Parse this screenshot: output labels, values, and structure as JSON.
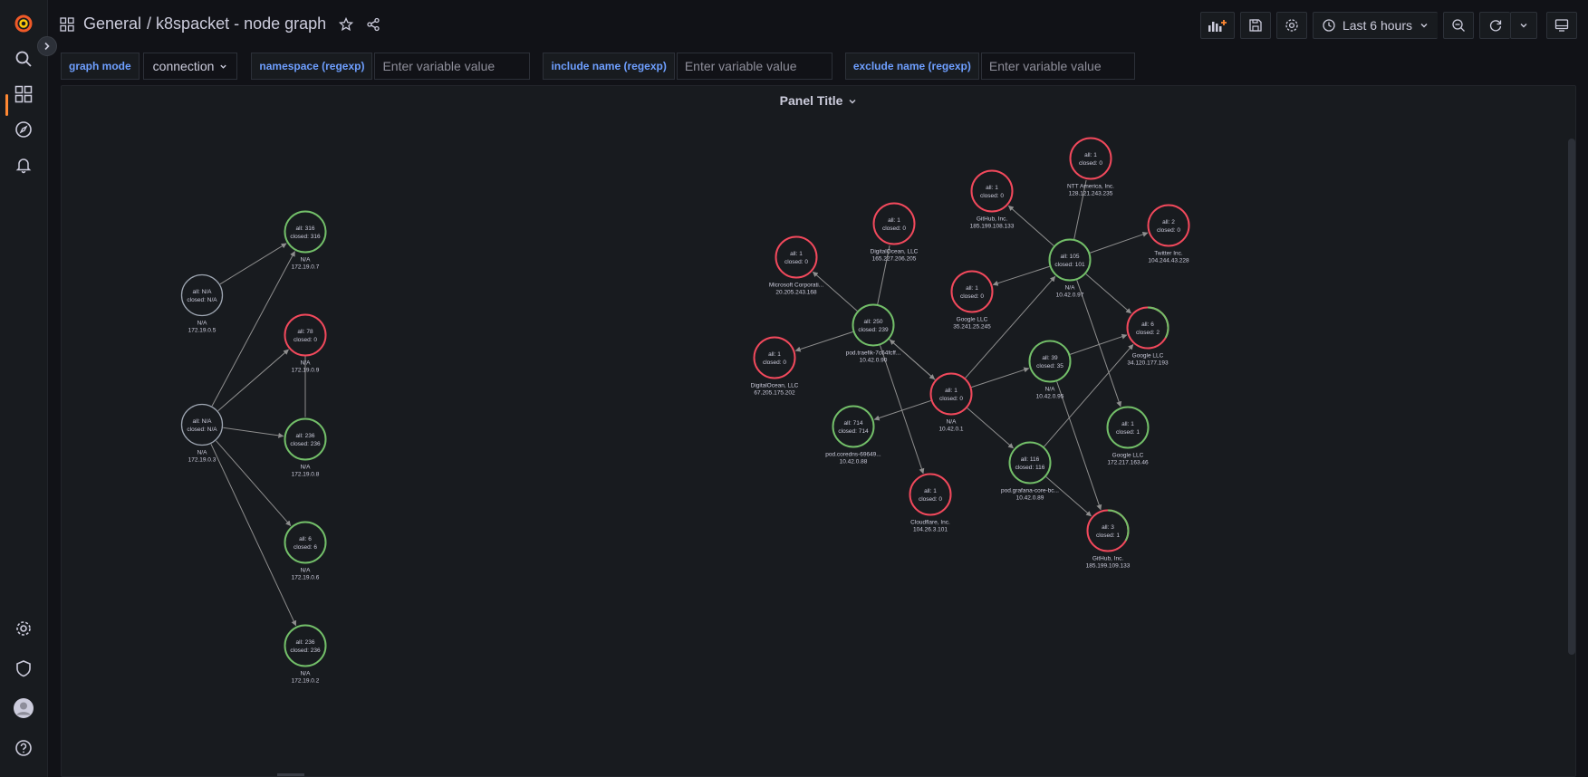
{
  "topnav": {
    "folder": "General",
    "dashboard": "/ k8spacket - node graph",
    "time_range": "Last 6 hours"
  },
  "variables": [
    {
      "label": "graph mode",
      "type": "select",
      "value": "connection"
    },
    {
      "label": "namespace (regexp)",
      "type": "input",
      "placeholder": "Enter variable value"
    },
    {
      "label": "include name (regexp)",
      "type": "input",
      "placeholder": "Enter variable value"
    },
    {
      "label": "exclude name (regexp)",
      "type": "input",
      "placeholder": "Enter variable value"
    }
  ],
  "panel": {
    "title": "Panel Title"
  },
  "colors": {
    "ok": "#73bf69",
    "error": "#f2495c",
    "neutral": "#9fa7b3",
    "edge": "#8e8e8e"
  },
  "nodes": [
    {
      "id": "n05",
      "l1": "all: N/A",
      "l2": "closed: N/A",
      "t1": "N/A",
      "t2": "172.19.0.5",
      "status": "neutral"
    },
    {
      "id": "n03",
      "l1": "all: N/A",
      "l2": "closed: N/A",
      "t1": "N/A",
      "t2": "172.19.0.3",
      "status": "neutral"
    },
    {
      "id": "n07",
      "l1": "all: 316",
      "l2": "closed: 316",
      "t1": "N/A",
      "t2": "172.19.0.7",
      "status": "ok"
    },
    {
      "id": "n09",
      "l1": "all: 78",
      "l2": "closed: 0",
      "t1": "N/A",
      "t2": "172.19.0.9",
      "status": "error"
    },
    {
      "id": "n08",
      "l1": "all: 236",
      "l2": "closed: 236",
      "t1": "N/A",
      "t2": "172.19.0.8",
      "status": "ok"
    },
    {
      "id": "n06",
      "l1": "all: 6",
      "l2": "closed: 6",
      "t1": "N/A",
      "t2": "172.19.0.6",
      "status": "ok"
    },
    {
      "id": "n02",
      "l1": "all: 236",
      "l2": "closed: 236",
      "t1": "N/A",
      "t2": "172.19.0.2",
      "status": "ok"
    },
    {
      "id": "ms",
      "l1": "all: 1",
      "l2": "closed: 0",
      "t1": "Microsoft Corporati...",
      "t2": "20.205.243.168",
      "status": "error"
    },
    {
      "id": "do1",
      "l1": "all: 1",
      "l2": "closed: 0",
      "t1": "DigitalOcean, LLC",
      "t2": "165.227.206.205",
      "status": "error"
    },
    {
      "id": "gh1",
      "l1": "all: 1",
      "l2": "closed: 0",
      "t1": "GitHub, Inc.",
      "t2": "185.199.108.133",
      "status": "error"
    },
    {
      "id": "ntt",
      "l1": "all: 1",
      "l2": "closed: 0",
      "t1": "NTT America, Inc.",
      "t2": "128.121.243.235",
      "status": "error"
    },
    {
      "id": "tw",
      "l1": "all: 2",
      "l2": "closed: 0",
      "t1": "Twitter Inc.",
      "t2": "104.244.43.228",
      "status": "error"
    },
    {
      "id": "g35",
      "l1": "all: 1",
      "l2": "closed: 0",
      "t1": "Google LLC",
      "t2": "35.241.25.245",
      "status": "error"
    },
    {
      "id": "n097",
      "l1": "all: 105",
      "l2": "closed: 101",
      "t1": "N/A",
      "t2": "10.42.0.97",
      "status": "ok"
    },
    {
      "id": "traefik",
      "l1": "all: 250",
      "l2": "closed: 239",
      "t1": "pod.traefik-7c64fcff...",
      "t2": "10.42.0.90",
      "status": "ok"
    },
    {
      "id": "do2",
      "l1": "all: 1",
      "l2": "closed: 0",
      "t1": "DigitalOcean, LLC",
      "t2": "67.205.175.202",
      "status": "error"
    },
    {
      "id": "g34",
      "l1": "all: 6",
      "l2": "closed: 2",
      "t1": "Google LLC",
      "t2": "34.120.177.193",
      "status": "mixed"
    },
    {
      "id": "n095",
      "l1": "all: 39",
      "l2": "closed: 35",
      "t1": "N/A",
      "t2": "10.42.0.95",
      "status": "ok"
    },
    {
      "id": "n01",
      "l1": "all: 1",
      "l2": "closed: 0",
      "t1": "N/A",
      "t2": "10.42.0.1",
      "status": "error"
    },
    {
      "id": "coredns",
      "l1": "all: 714",
      "l2": "closed: 714",
      "t1": "pod.coredns-69649...",
      "t2": "10.42.0.88",
      "status": "ok"
    },
    {
      "id": "g172",
      "l1": "all: 1",
      "l2": "closed: 1",
      "t1": "Google LLC",
      "t2": "172.217.163.46",
      "status": "ok"
    },
    {
      "id": "grafana",
      "l1": "all: 116",
      "l2": "closed: 116",
      "t1": "pod.grafana-core-bc...",
      "t2": "10.42.0.89",
      "status": "ok"
    },
    {
      "id": "cf",
      "l1": "all: 1",
      "l2": "closed: 0",
      "t1": "Cloudflare, Inc.",
      "t2": "104.26.3.101",
      "status": "error"
    },
    {
      "id": "gh2",
      "l1": "all: 3",
      "l2": "closed: 1",
      "t1": "GitHub, Inc.",
      "t2": "185.199.109.133",
      "status": "mixed"
    }
  ],
  "edges": [
    [
      "n05",
      "n07"
    ],
    [
      "n03",
      "n07"
    ],
    [
      "n03",
      "n09"
    ],
    [
      "n03",
      "n08"
    ],
    [
      "n03",
      "n06"
    ],
    [
      "n03",
      "n02"
    ],
    [
      "n09",
      "n08"
    ],
    [
      "traefik",
      "ms"
    ],
    [
      "traefik",
      "do1"
    ],
    [
      "traefik",
      "do2"
    ],
    [
      "traefik",
      "n01"
    ],
    [
      "traefik",
      "cf"
    ],
    [
      "n01",
      "traefik"
    ],
    [
      "n01",
      "coredns"
    ],
    [
      "n01",
      "n095"
    ],
    [
      "n01",
      "grafana"
    ],
    [
      "n01",
      "n097"
    ],
    [
      "n097",
      "gh1"
    ],
    [
      "n097",
      "ntt"
    ],
    [
      "n097",
      "tw"
    ],
    [
      "n097",
      "g35"
    ],
    [
      "n097",
      "g34"
    ],
    [
      "n097",
      "g172"
    ],
    [
      "n095",
      "g34"
    ],
    [
      "n095",
      "gh2"
    ],
    [
      "grafana",
      "g34"
    ],
    [
      "grafana",
      "gh2"
    ]
  ]
}
